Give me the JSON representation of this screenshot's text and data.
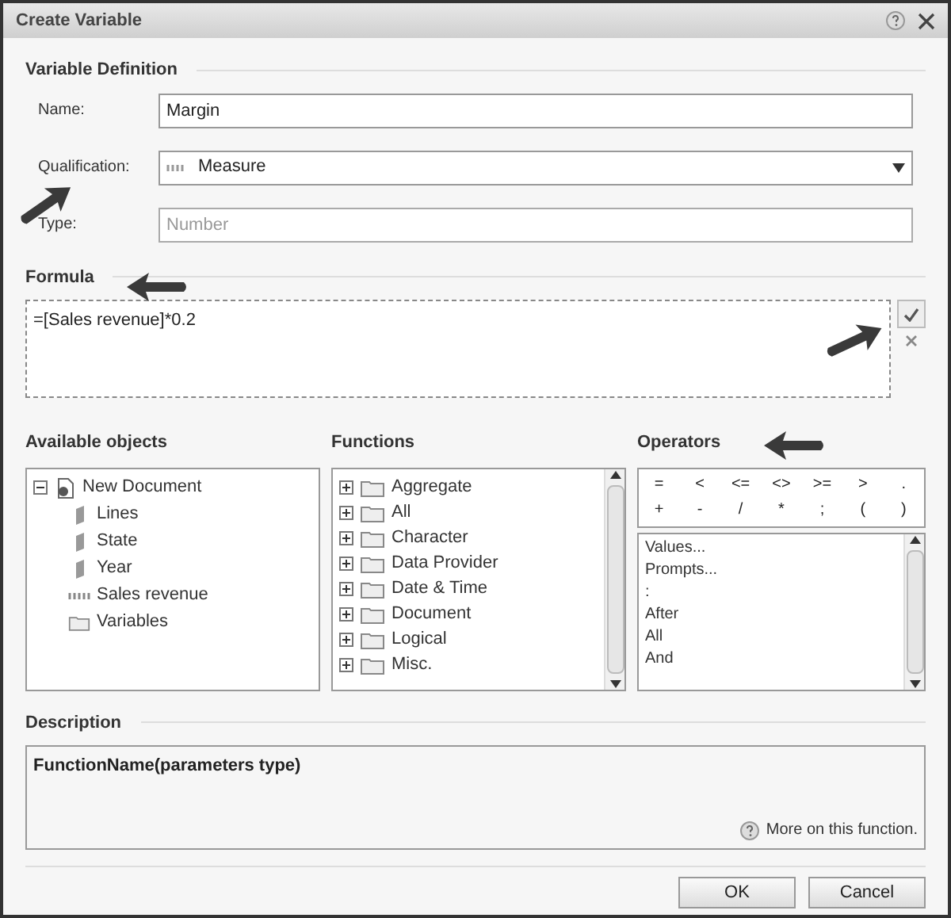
{
  "window": {
    "title": "Create Variable"
  },
  "definition": {
    "heading": "Variable Definition",
    "name": {
      "label": "Name:",
      "value": "Margin"
    },
    "qualification": {
      "label": "Qualification:",
      "value": "Measure"
    },
    "type": {
      "label": "Type:",
      "placeholder": "Number"
    }
  },
  "formula": {
    "heading": "Formula",
    "value": "=[Sales revenue]*0.2"
  },
  "available_objects": {
    "heading": "Available objects",
    "tree": [
      {
        "label": "New Document",
        "kind": "document",
        "expanded": true,
        "children": [
          {
            "label": "Lines",
            "kind": "dimension"
          },
          {
            "label": "State",
            "kind": "dimension"
          },
          {
            "label": "Year",
            "kind": "dimension"
          },
          {
            "label": "Sales revenue",
            "kind": "measure"
          },
          {
            "label": "Variables",
            "kind": "folder"
          }
        ]
      }
    ]
  },
  "functions": {
    "heading": "Functions",
    "items": [
      {
        "label": "Aggregate",
        "expanded": false
      },
      {
        "label": "All",
        "expanded": false
      },
      {
        "label": "Character",
        "expanded": false
      },
      {
        "label": "Data Provider",
        "expanded": false
      },
      {
        "label": "Date & Time",
        "expanded": false
      },
      {
        "label": "Document",
        "expanded": false
      },
      {
        "label": "Logical",
        "expanded": false
      },
      {
        "label": "Misc.",
        "expanded": false
      }
    ]
  },
  "operators": {
    "heading": "Operators",
    "symbols": [
      "=",
      "<",
      "<=",
      "<>",
      ">=",
      ">",
      ".",
      "+",
      "-",
      "/",
      "*",
      ";",
      "(",
      ")"
    ],
    "items": [
      "Values...",
      "Prompts...",
      ":",
      "After",
      "All",
      "And"
    ]
  },
  "description": {
    "heading": "Description",
    "text": "FunctionName(parameters type)",
    "link": "More on this function."
  },
  "buttons": [
    "OK",
    "Cancel"
  ]
}
